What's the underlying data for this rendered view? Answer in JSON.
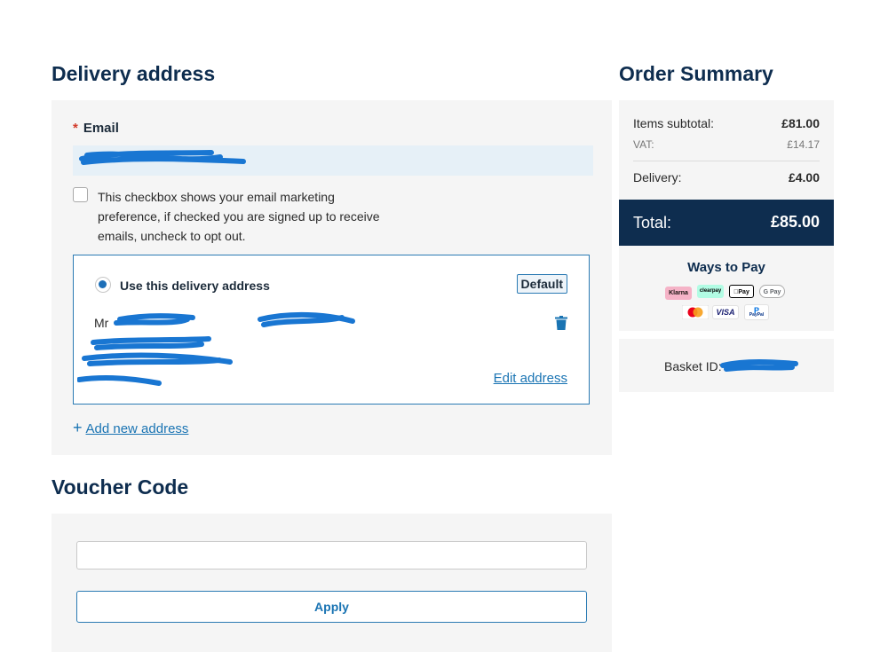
{
  "delivery": {
    "title": "Delivery address",
    "email_label": "Email",
    "required_marker": "*",
    "email_value": "",
    "marketing_text": "This checkbox shows your email marketing preference, if checked you are signed up to receive emails, uncheck to opt out.",
    "marketing_checked": false,
    "address_card": {
      "use_label": "Use this delivery address",
      "default_badge": "Default",
      "name_prefix": "Mr",
      "edit_link": "Edit address"
    },
    "add_new_address": "Add new address"
  },
  "voucher": {
    "title": "Voucher Code",
    "input_value": "",
    "apply_label": "Apply"
  },
  "summary": {
    "title": "Order Summary",
    "items_subtotal_label": "Items subtotal:",
    "items_subtotal_value": "£81.00",
    "vat_label": "VAT:",
    "vat_value": "£14.17",
    "delivery_label": "Delivery:",
    "delivery_value": "£4.00",
    "total_label": "Total:",
    "total_value": "£85.00",
    "ways_to_pay": "Ways to Pay",
    "payment_methods": [
      "Klarna",
      "clearpay",
      "Pay",
      "G Pay",
      "VISA",
      "PayPal"
    ],
    "basket_label": "Basket ID:"
  },
  "colors": {
    "navy": "#0e2d4f",
    "link_blue": "#1a74b3",
    "panel_bg": "#f5f5f5",
    "scribble_blue": "#1976d2"
  }
}
